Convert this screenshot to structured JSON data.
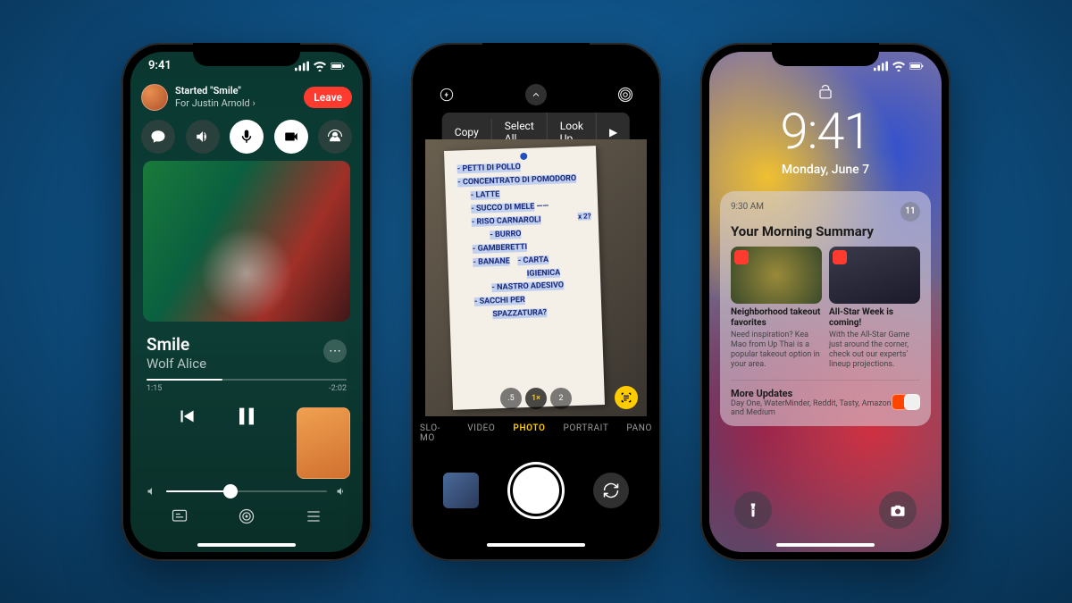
{
  "status": {
    "time": "9:41"
  },
  "phone1": {
    "banner": {
      "title": "Started \"Smile\"",
      "subtitle": "For Justin Arnold ›",
      "leave": "Leave"
    },
    "track": {
      "title": "Smile",
      "artist": "Wolf Alice",
      "elapsed": "1:15",
      "remaining": "-2:02"
    }
  },
  "phone2": {
    "menu": {
      "copy": "Copy",
      "selectAll": "Select All",
      "lookUp": "Look Up",
      "more": "▶"
    },
    "note": {
      "l1": "- PETTI DI POLLO",
      "l2": "- CONCENTRATO DI POMODORO",
      "l3": "- LATTE",
      "l3b": "x 2?",
      "l4": "- SUCCO DI MELE",
      "l5": "- RISO CARNAROLI",
      "l6": "- BURRO",
      "l7": "- GAMBERETTI",
      "l8a": "- BANANE",
      "l8b": "- CARTA",
      "l8c": "IGIENICA",
      "l9": "- NASTRO ADESIVO",
      "l10": "- SACCHI PER",
      "l11": "SPAZZATURA?"
    },
    "zoom": {
      "z1": ".5",
      "z2": "1×",
      "z3": "2"
    },
    "modes": {
      "m1": "SLO-MO",
      "m2": "VIDEO",
      "m3": "PHOTO",
      "m4": "PORTRAIT",
      "m5": "PANO"
    }
  },
  "phone3": {
    "time": "9:41",
    "date": "Monday, June 7",
    "summary": {
      "ts": "9:30 AM",
      "badge": "11",
      "title": "Your Morning Summary",
      "tile1": {
        "t": "Neighborhood takeout favorites",
        "d": "Need inspiration? Kea Mao from Up Thai is a popular takeout option in your area."
      },
      "tile2": {
        "t": "All-Star Week is coming!",
        "d": "With the All-Star Game just around the corner, check out our experts' lineup projections."
      },
      "more": {
        "t": "More Updates",
        "d": "Day One, WaterMinder, Reddit, Tasty, Amazon, and Medium"
      }
    }
  }
}
